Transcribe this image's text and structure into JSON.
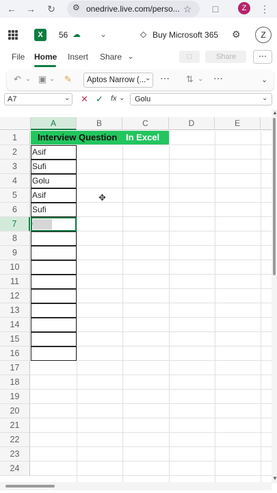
{
  "browser": {
    "url": "onedrive.live.com/perso...",
    "profile_initial": "Z"
  },
  "app": {
    "autosave_count": "56",
    "buy_label": "Buy Microsoft 365",
    "user_initial": "Z"
  },
  "tabs": [
    {
      "label": "File"
    },
    {
      "label": "Home"
    },
    {
      "label": "Insert"
    },
    {
      "label": "Share"
    }
  ],
  "toolbar": {
    "font_name": "Aptos Narrow (..."
  },
  "formula_bar": {
    "name_box": "A7",
    "formula": "Golu",
    "fx": "fx"
  },
  "share_button": "Share",
  "columns": [
    "A",
    "B",
    "C",
    "D",
    "E"
  ],
  "rows": [
    "1",
    "2",
    "3",
    "4",
    "5",
    "6",
    "7",
    "8",
    "9",
    "10",
    "11",
    "12",
    "13",
    "14",
    "15",
    "16",
    "17",
    "18",
    "19",
    "20",
    "21",
    "22",
    "23",
    "24"
  ],
  "title_cell": {
    "part1": "Interview Question",
    "part2": "In Excel"
  },
  "cells_a": [
    "Asif",
    "Sufi",
    "Golu",
    "Asif",
    "Sufi",
    "Golu"
  ],
  "selected_cell": "A7",
  "colors": {
    "accent": "#107c41",
    "title_fill": "#22c55e"
  }
}
